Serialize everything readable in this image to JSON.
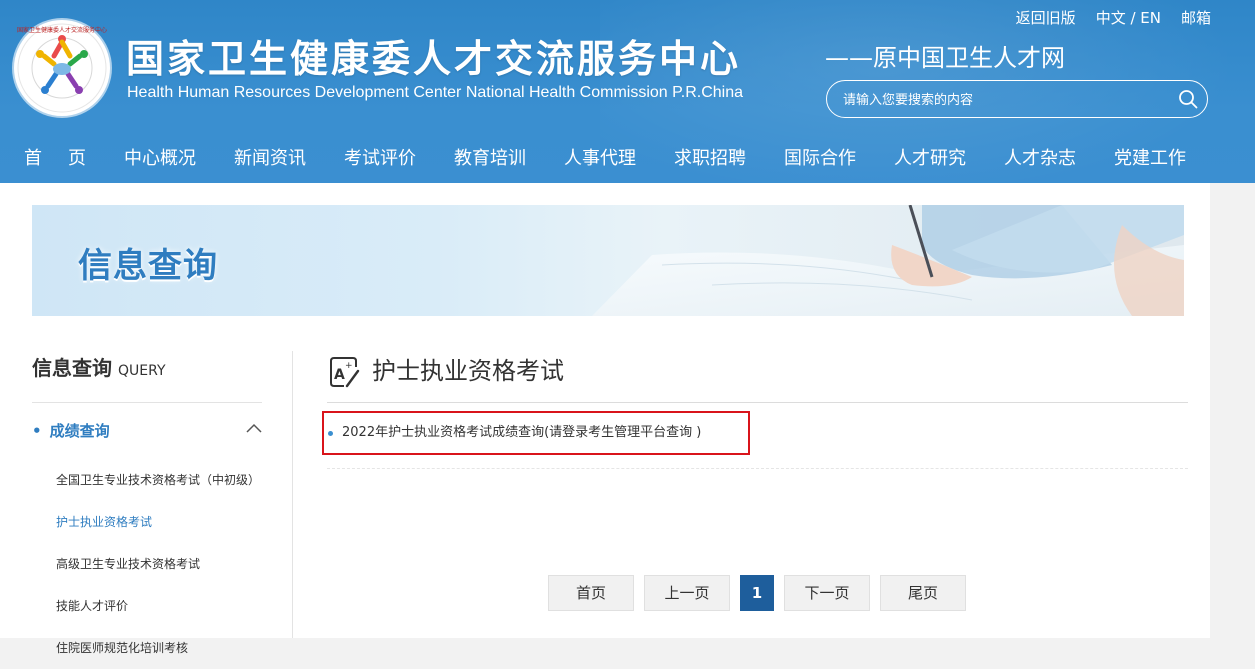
{
  "header": {
    "title": "国家卫生健康委人才交流服务中心",
    "title_en": "Health Human Resources Development Center National Health Commission P.R.China",
    "subtitle": "——原中国卫生人才网",
    "logo_text": "国家卫生健康委人才交流服务中心",
    "top_links": [
      "返回旧版",
      "中文 / EN",
      "邮箱"
    ],
    "search_placeholder": "请输入您要搜索的内容"
  },
  "nav": [
    "首页",
    "中心概况",
    "新闻资讯",
    "考试评价",
    "教育培训",
    "人事代理",
    "求职招聘",
    "国际合作",
    "人才研究",
    "人才杂志",
    "党建工作"
  ],
  "banner": {
    "title": "信息查询"
  },
  "sidebar": {
    "title": "信息查询",
    "title_en": "QUERY",
    "category": "成绩查询",
    "items": [
      "全国卫生专业技术资格考试（中初级）",
      "护士执业资格考试",
      "高级卫生专业技术资格考试",
      "技能人才评价",
      "住院医师规范化培训考核"
    ],
    "active_index": 1
  },
  "main": {
    "title": "护士执业资格考试",
    "list": [
      "2022年护士执业资格考试成绩查询(请登录考生管理平台查询 )"
    ]
  },
  "pager": {
    "first": "首页",
    "prev": "上一页",
    "current": "1",
    "next": "下一页",
    "last": "尾页"
  },
  "colors": {
    "header_blue": "#3a8fd0",
    "accent_blue": "#2f7dc0",
    "pager_active": "#1e5e9c",
    "highlight_red": "#d9141b"
  }
}
